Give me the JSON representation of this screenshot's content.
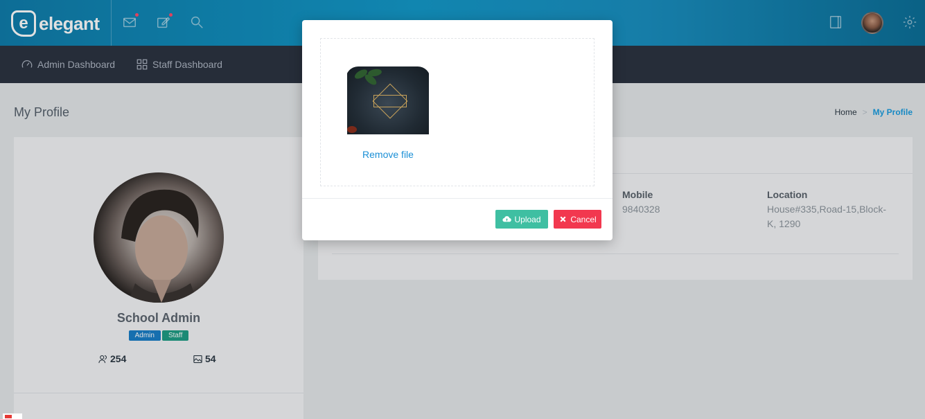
{
  "header": {
    "logo_mark": "e",
    "logo_text": "elegant",
    "icons": [
      "mail-icon",
      "edit-icon",
      "search-icon",
      "layout-icon",
      "settings-icon"
    ]
  },
  "nav": {
    "items": [
      {
        "label": "Admin Dashboard",
        "icon": "speedometer-icon"
      },
      {
        "label": "Staff Dashboard",
        "icon": "grid-icon"
      }
    ]
  },
  "page": {
    "title": "My Profile",
    "breadcrumb": {
      "home": "Home",
      "current": "My Profile"
    }
  },
  "profile": {
    "name": "School Admin",
    "badges": [
      "Admin",
      "Staff"
    ],
    "stats": {
      "followers": "254",
      "photos": "54"
    }
  },
  "details": {
    "mobile_label": "Mobile",
    "mobile_value": "9840328",
    "location_label": "Location",
    "location_line1": "House#335,Road-15,Block-",
    "location_line2": "K, 1290"
  },
  "modal": {
    "remove_file": "Remove file",
    "upload_label": "Upload",
    "cancel_label": "Cancel"
  },
  "colors": {
    "header_blue": "#1499c9",
    "nav_dark": "#2c3441",
    "link_blue": "#1a9de0",
    "upload_green": "#3fbfa2",
    "cancel_red": "#f2384f",
    "badge_admin": "#1a7fc8",
    "badge_staff": "#1f9e86"
  }
}
